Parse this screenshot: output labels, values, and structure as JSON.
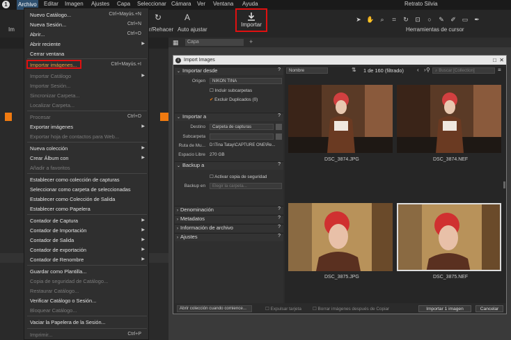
{
  "menubar": {
    "items": [
      "Archivo",
      "Editar",
      "Imagen",
      "Ajustes",
      "Capa",
      "Seleccionar",
      "Cámara",
      "Ver",
      "Ventana",
      "Ayuda"
    ],
    "session_title": "Retrato Silvia"
  },
  "toolbar": {
    "undo_label": "r/Rehacer",
    "auto_adjust_label": "Auto ajustar",
    "import_label": "Importar",
    "cursor_tools_label": "Herramientas de cursor",
    "left_fragment": "Im"
  },
  "file_menu": {
    "items": [
      {
        "label": "Nuevo Catálogo...",
        "shortcut": "Ctrl+Mayús.+N",
        "disabled": false
      },
      {
        "label": "Nueva Sesión...",
        "shortcut": "Ctrl+N",
        "disabled": false
      },
      {
        "label": "Abrir...",
        "shortcut": "Ctrl+O",
        "disabled": false
      },
      {
        "label": "Abrir reciente",
        "shortcut": "",
        "disabled": false,
        "submenu": true
      },
      {
        "label": "Cerrar ventana",
        "shortcut": "",
        "disabled": false
      },
      {
        "label": "Importar imágenes...",
        "shortcut": "Ctrl+Mayús.+I",
        "disabled": false,
        "highlight": true
      },
      {
        "label": "Importar Catálogo",
        "shortcut": "",
        "disabled": true,
        "submenu": true
      },
      {
        "label": "Importar Sesión...",
        "shortcut": "",
        "disabled": true
      },
      {
        "label": "Sincronizar Carpeta...",
        "shortcut": "",
        "disabled": true
      },
      {
        "label": "Localizar Carpeta...",
        "shortcut": "",
        "disabled": true
      },
      {
        "label": "Procesar",
        "shortcut": "Ctrl+D",
        "disabled": true
      },
      {
        "label": "Exportar imágenes",
        "shortcut": "",
        "disabled": false,
        "submenu": true
      },
      {
        "label": "Exportar hoja de contactos para Web...",
        "shortcut": "",
        "disabled": true
      },
      {
        "label": "Nueva colección",
        "shortcut": "",
        "disabled": false,
        "submenu": true
      },
      {
        "label": "Crear Álbum con",
        "shortcut": "",
        "disabled": false,
        "submenu": true
      },
      {
        "label": "Añadir a favoritos",
        "shortcut": "",
        "disabled": true
      },
      {
        "label": "Establecer como colección de capturas",
        "shortcut": "",
        "disabled": false
      },
      {
        "label": "Seleccionar como carpeta de seleccionadas",
        "shortcut": "",
        "disabled": false
      },
      {
        "label": "Establecer como Colección de Salida",
        "shortcut": "",
        "disabled": false
      },
      {
        "label": "Establecer como Papelera",
        "shortcut": "",
        "disabled": false
      },
      {
        "label": "Contador de Captura",
        "shortcut": "",
        "disabled": false,
        "submenu": true
      },
      {
        "label": "Contador de Importación",
        "shortcut": "",
        "disabled": false,
        "submenu": true
      },
      {
        "label": "Contador de Salida",
        "shortcut": "",
        "disabled": false,
        "submenu": true
      },
      {
        "label": "Contador de exportación",
        "shortcut": "",
        "disabled": false,
        "submenu": true
      },
      {
        "label": "Contador de Renombre",
        "shortcut": "",
        "disabled": false,
        "submenu": true
      },
      {
        "label": "Guardar como Plantilla...",
        "shortcut": "",
        "disabled": false
      },
      {
        "label": "Copia de seguridad de Catálogo...",
        "shortcut": "",
        "disabled": true
      },
      {
        "label": "Restaurar Catálogo...",
        "shortcut": "",
        "disabled": true
      },
      {
        "label": "Verificar Catálogo o Sesión...",
        "shortcut": "",
        "disabled": false
      },
      {
        "label": "Bloquear Catálogo...",
        "shortcut": "",
        "disabled": true
      },
      {
        "label": "Vaciar la Papelera de la Sesión...",
        "shortcut": "",
        "disabled": false
      },
      {
        "label": "Imprimir...",
        "shortcut": "Ctrl+P",
        "disabled": true
      }
    ]
  },
  "viewer": {
    "layer_select": "Capa"
  },
  "dialog": {
    "title": "Import Images",
    "import_from": {
      "header": "Importar desde",
      "origin_label": "Origen",
      "origin_value": "NIKON TINA",
      "include_subfolders": "Incluir subcarpetas",
      "exclude_duplicates": "Excluir Duplicados (0)"
    },
    "import_to": {
      "header": "Importar a",
      "dest_label": "Destino",
      "dest_value": "Carpeta de capturas",
      "subfolder_label": "Subcarpeta",
      "path_label": "Ruta de Mu...",
      "path_value": "D:\\Tina Tatay\\CAPTURE ONE\\Re...",
      "free_label": "Espacio Libre",
      "free_value": "270 GB"
    },
    "backup": {
      "header": "Backup a",
      "activate": "Activar copia de seguridad",
      "location_label": "Backup en",
      "location_value": "Elegir la carpeta..."
    },
    "sections": [
      "Denominación",
      "Metadatos",
      "Información de archivo",
      "Ajustes"
    ],
    "browser": {
      "sort": "Nombre",
      "count": "1 de 160 (filtrado)",
      "search_placeholder": "Buscar [Collection]",
      "thumbs": [
        "DSC_3874.JPG",
        "DSC_3874.NEF",
        "DSC_3875.JPG",
        "DSC_3875.NEF"
      ]
    },
    "footer": {
      "open_collection": "Abrir colección cuando comience...",
      "eject_card": "Expulsar tarjeta",
      "delete_after": "Borrar imágenes después de Copiar",
      "import_button": "Importar 1 imagen",
      "cancel_button": "Cancelar"
    }
  },
  "colors": {
    "highlight_border": "#e01010",
    "accent_orange": "#f07a10",
    "menu_bg": "#2f2f2f"
  }
}
